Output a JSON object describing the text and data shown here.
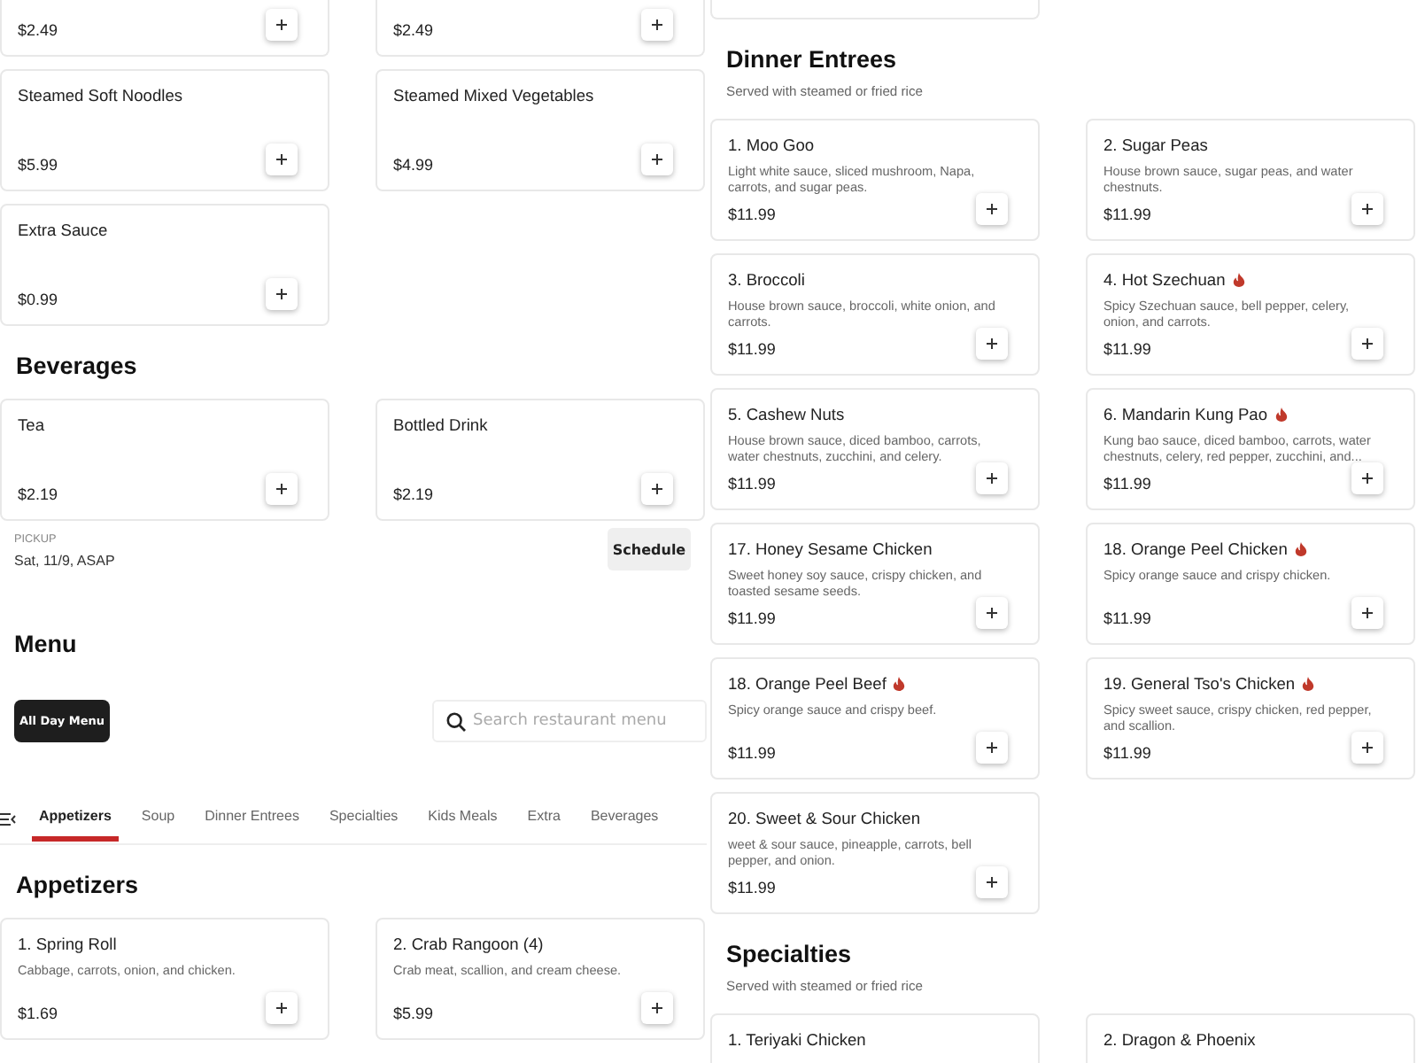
{
  "left_column": {
    "sections": [
      {
        "items": [
          {
            "kind": "cut",
            "price": "$2.49"
          },
          {
            "kind": "cut",
            "price": "$2.49"
          },
          {
            "kind": "full",
            "name": "Steamed Soft Noodles",
            "price": "$5.99",
            "spicy": false
          },
          {
            "kind": "full",
            "name": "Steamed Mixed Vegetables",
            "price": "$4.99",
            "spicy": false
          },
          {
            "kind": "full",
            "name": "Extra Sauce",
            "price": "$0.99",
            "spicy": false
          }
        ]
      },
      {
        "heading": "Beverages",
        "items": [
          {
            "kind": "full",
            "name": "Tea",
            "price": "$2.19",
            "spicy": false
          },
          {
            "kind": "full",
            "name": "Bottled Drink",
            "price": "$2.19",
            "spicy": false
          }
        ]
      }
    ],
    "pickup": {
      "label": "PICKUP",
      "value": "Sat, 11/9, ASAP",
      "button": "Schedule"
    },
    "menu": {
      "title": "Menu",
      "menu_button": "All Day Menu",
      "search": {
        "placeholder": "Search restaurant menu"
      }
    },
    "tabs": [
      {
        "label": "Appetizers",
        "selected": true
      },
      {
        "label": "Soup",
        "selected": false
      },
      {
        "label": "Dinner Entrees",
        "selected": false
      },
      {
        "label": "Specialties",
        "selected": false
      },
      {
        "label": "Kids Meals",
        "selected": false
      },
      {
        "label": "Extra",
        "selected": false
      },
      {
        "label": "Beverages",
        "selected": false
      }
    ],
    "menu_sections": [
      {
        "heading": "Appetizers",
        "items": [
          {
            "kind": "full",
            "name": "1. Spring Roll",
            "description": "Cabbage, carrots, onion, and chicken.",
            "price": "$1.69",
            "spicy": false
          },
          {
            "kind": "full",
            "name": "2. Crab Rangoon (4)",
            "description": "Crab meat, scallion, and cream cheese.",
            "price": "$5.99",
            "spicy": false
          }
        ]
      }
    ]
  },
  "right_column": {
    "sections": [
      {
        "items": [
          {
            "kind": "cut"
          }
        ]
      },
      {
        "heading": "Dinner Entrees",
        "subtitle": "Served with steamed or fried rice",
        "items": [
          {
            "kind": "full",
            "name": "1. Moo Goo",
            "description": "Light white sauce, sliced mushroom, Napa, carrots, and sugar peas.",
            "price": "$11.99",
            "spicy": false
          },
          {
            "kind": "full",
            "name": "2. Sugar Peas",
            "description": "House brown sauce, sugar peas, and water chestnuts.",
            "price": "$11.99",
            "spicy": false
          },
          {
            "kind": "full",
            "name": "3. Broccoli",
            "description": "House brown sauce, broccoli, white onion, and carrots.",
            "price": "$11.99",
            "spicy": false
          },
          {
            "kind": "full",
            "name": "4. Hot Szechuan",
            "description": "Spicy Szechuan sauce, bell pepper, celery, onion, and carrots.",
            "price": "$11.99",
            "spicy": true
          },
          {
            "kind": "full",
            "name": "5. Cashew Nuts",
            "description": "House brown sauce, diced bamboo, carrots, water chestnuts, zucchini, and celery.",
            "price": "$11.99",
            "spicy": false
          },
          {
            "kind": "full",
            "name": "6. Mandarin Kung Pao",
            "description": "Kung bao sauce, diced bamboo, carrots, water chestnuts, celery, red pepper, zucchini, and...",
            "price": "$11.99",
            "spicy": true
          },
          {
            "kind": "full",
            "name": "17. Honey Sesame Chicken",
            "description": "Sweet honey soy sauce, crispy chicken, and toasted sesame seeds.",
            "price": "$11.99",
            "spicy": false
          },
          {
            "kind": "full",
            "name": "18. Orange Peel Chicken",
            "description": "Spicy orange sauce and crispy chicken.",
            "price": "$11.99",
            "spicy": true
          },
          {
            "kind": "full",
            "name": "18. Orange Peel Beef",
            "description": "Spicy orange sauce and crispy beef.",
            "price": "$11.99",
            "spicy": true
          },
          {
            "kind": "full",
            "name": "19. General Tso's Chicken",
            "description": "Spicy sweet sauce, crispy chicken, red pepper, and scallion.",
            "price": "$11.99",
            "spicy": true
          },
          {
            "kind": "full",
            "name": "20. Sweet & Sour Chicken",
            "description": "weet & sour sauce, pineapple, carrots, bell pepper, and onion.",
            "price": "$11.99",
            "spicy": false
          }
        ]
      },
      {
        "heading": "Specialties",
        "subtitle": "Served with steamed or fried rice",
        "items": [
          {
            "kind": "full",
            "name": "1. Teriyaki Chicken",
            "spicy": false
          },
          {
            "kind": "full",
            "name": "2. Dragon & Phoenix",
            "spicy": false
          }
        ]
      }
    ]
  }
}
